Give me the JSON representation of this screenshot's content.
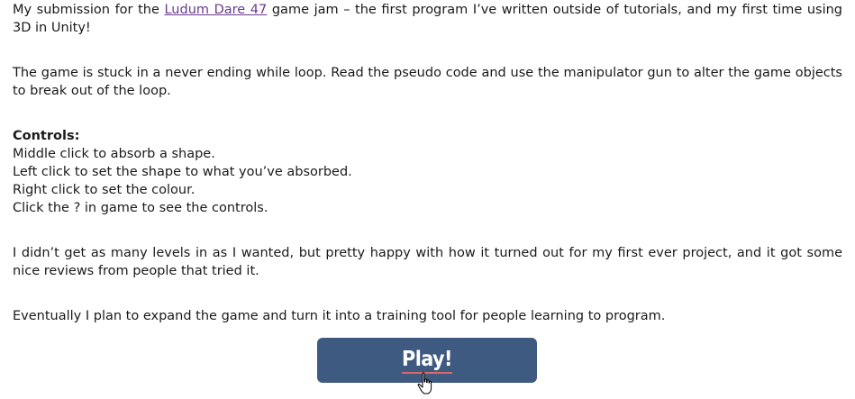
{
  "intro": {
    "prefix": "My submission for the ",
    "link_text": "Ludum Dare 47",
    "suffix": " game jam – the first program I’ve written outside of tutorials, and my first time using 3D in Unity!"
  },
  "description": "The game is stuck in a never ending while loop. Read the pseudo code and use the manipulator gun to alter the game objects to break out of the loop.",
  "controls": {
    "heading": "Controls:",
    "lines": [
      "Middle click to absorb a shape.",
      "Left click to set the shape to what you’ve absorbed.",
      "Right click to set the colour.",
      "Click the ? in game to see the controls."
    ]
  },
  "reflection": "I didn’t get as many levels in as I wanted, but pretty happy with how it turned out for my first ever project, and it got some nice reviews from people that tried it.",
  "plans": "Eventually I plan to expand the game and turn it into a training tool for people learning to program.",
  "play_button": {
    "label": "Play!",
    "color": "#3f5a80"
  },
  "cursor": {
    "icon": "hand-pointer-icon"
  }
}
